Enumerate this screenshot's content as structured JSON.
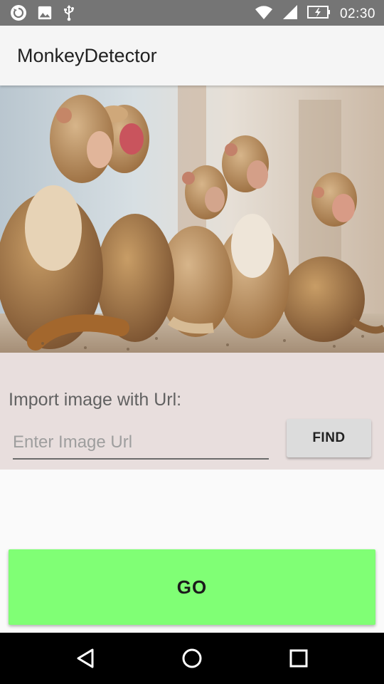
{
  "status_bar": {
    "time": "02:30",
    "icons_left": [
      "sync-icon",
      "image-icon",
      "usb-icon"
    ],
    "icons_right": [
      "wifi-icon",
      "signal-icon",
      "battery-charging-icon"
    ]
  },
  "app_bar": {
    "title": "MonkeyDetector"
  },
  "hero_image": {
    "subject": "monkeys-photo"
  },
  "import_panel": {
    "label": "Import image with Url:",
    "url_input": {
      "value": "",
      "placeholder": "Enter Image Url"
    },
    "find_button_label": "FIND",
    "background": "#e8dedd"
  },
  "go_button": {
    "label": "GO",
    "color": "#80ff75"
  },
  "nav_bar": {
    "buttons": [
      "back-icon",
      "home-icon",
      "recents-icon"
    ]
  }
}
